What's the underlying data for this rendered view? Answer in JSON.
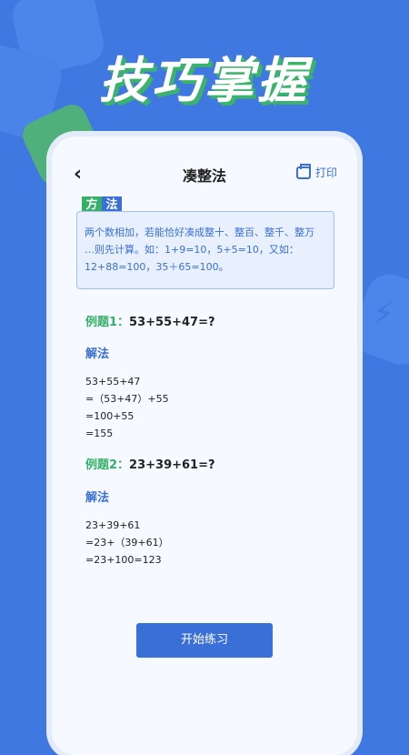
{
  "hero": {
    "title": "技巧掌握"
  },
  "nav": {
    "title": "凑整法",
    "print_label": "打印"
  },
  "method": {
    "tag_1": "方",
    "tag_2": "法",
    "line_1": "两个数相加，若能恰好凑成整十、整百、整千、整万",
    "line_2": "…则先计算。如：1+9=10，5+5=10，又如：",
    "line_3": "12+88=100，35＋65=100。"
  },
  "examples": [
    {
      "label": "例题1：",
      "expression": "53+55+47=?",
      "solution_label": "解法",
      "steps": [
        "53+55+47",
        "=（53+47）+55",
        "=100+55",
        "=155"
      ]
    },
    {
      "label": "例题2：",
      "expression": "23+39+61=?",
      "solution_label": "解法",
      "steps": [
        "23+39+61",
        "=23+（39+61）",
        "=23+100=123"
      ]
    }
  ],
  "actions": {
    "start_label": "开始练习"
  },
  "colors": {
    "background": "#3f78e0",
    "accent": "#3a6fd8",
    "green": "#34b067"
  }
}
